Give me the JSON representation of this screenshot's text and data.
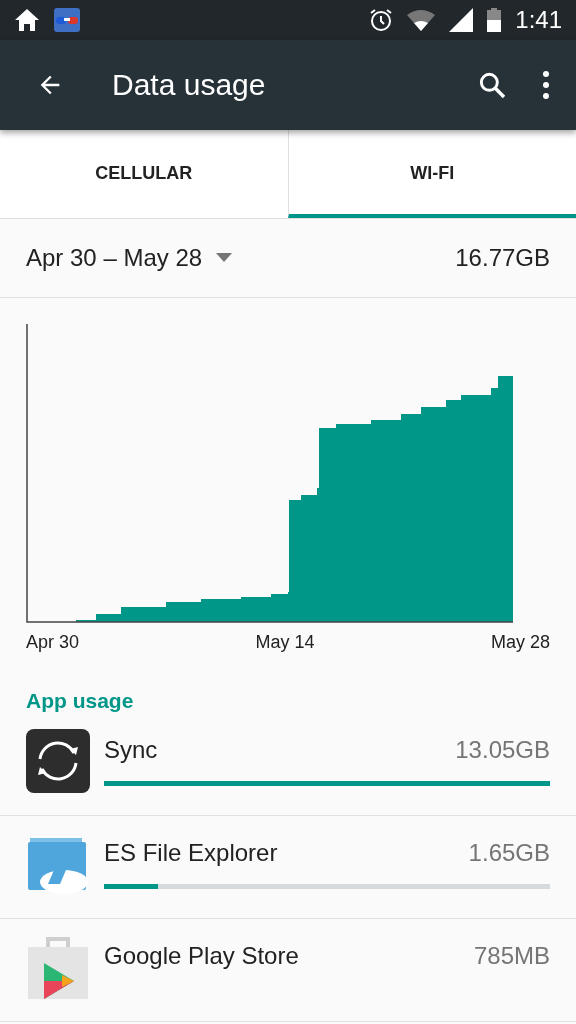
{
  "status_bar": {
    "time": "1:41"
  },
  "toolbar": {
    "title": "Data usage"
  },
  "tabs": [
    {
      "label": "CELLULAR",
      "selected": false
    },
    {
      "label": "WI-FI",
      "selected": true
    }
  ],
  "period": {
    "range": "Apr 30 – May 28",
    "total": "16.77GB"
  },
  "chart": {
    "x_labels": [
      "Apr 30",
      "May 14",
      "May 28"
    ]
  },
  "app_usage": {
    "heading": "App usage",
    "apps": [
      {
        "name": "Sync",
        "amount": "13.05GB",
        "level": 1.0
      },
      {
        "name": "ES File Explorer",
        "amount": "1.65GB",
        "level": 0.12
      },
      {
        "name": "Google Play Store",
        "amount": "785MB"
      }
    ]
  }
}
